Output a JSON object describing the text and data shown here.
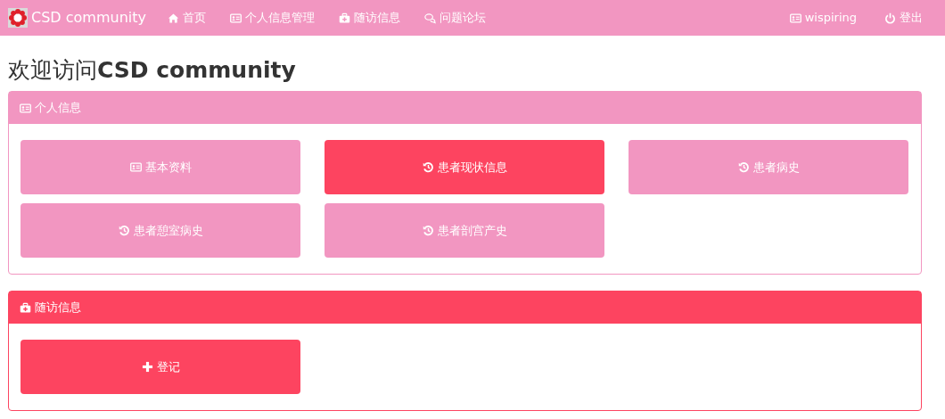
{
  "navbar": {
    "brand": "CSD community",
    "items": [
      {
        "kind": "home",
        "label": "首页"
      },
      {
        "kind": "profile",
        "label": "个人信息管理"
      },
      {
        "kind": "followup",
        "label": "随访信息"
      },
      {
        "kind": "forum",
        "label": "问题论坛"
      }
    ],
    "right": [
      {
        "kind": "profile",
        "label": "wispiring"
      },
      {
        "kind": "logout",
        "label": "登出"
      }
    ]
  },
  "heading": "欢迎访问**CSD community**",
  "panels": [
    {
      "kind": "profile",
      "title": "个人信息",
      "color": "#f296c1",
      "buttons": [
        {
          "kind": "profile",
          "label": "基本资料",
          "color": "#f296c1"
        },
        {
          "kind": "history",
          "label": "患者现状信息",
          "color": "#fd4460"
        },
        {
          "kind": "history",
          "label": "患者病史",
          "color": "#f296c1"
        },
        {
          "kind": "history",
          "label": "患者憩室病史",
          "color": "#f296c1"
        },
        {
          "kind": "history",
          "label": "患者剖宫产史",
          "color": "#f296c1"
        }
      ]
    },
    {
      "kind": "followup",
      "title": "随访信息",
      "color": "#fd4460",
      "buttons": [
        {
          "kind": "add",
          "label": "登记",
          "color": "#fd4460"
        }
      ]
    }
  ]
}
